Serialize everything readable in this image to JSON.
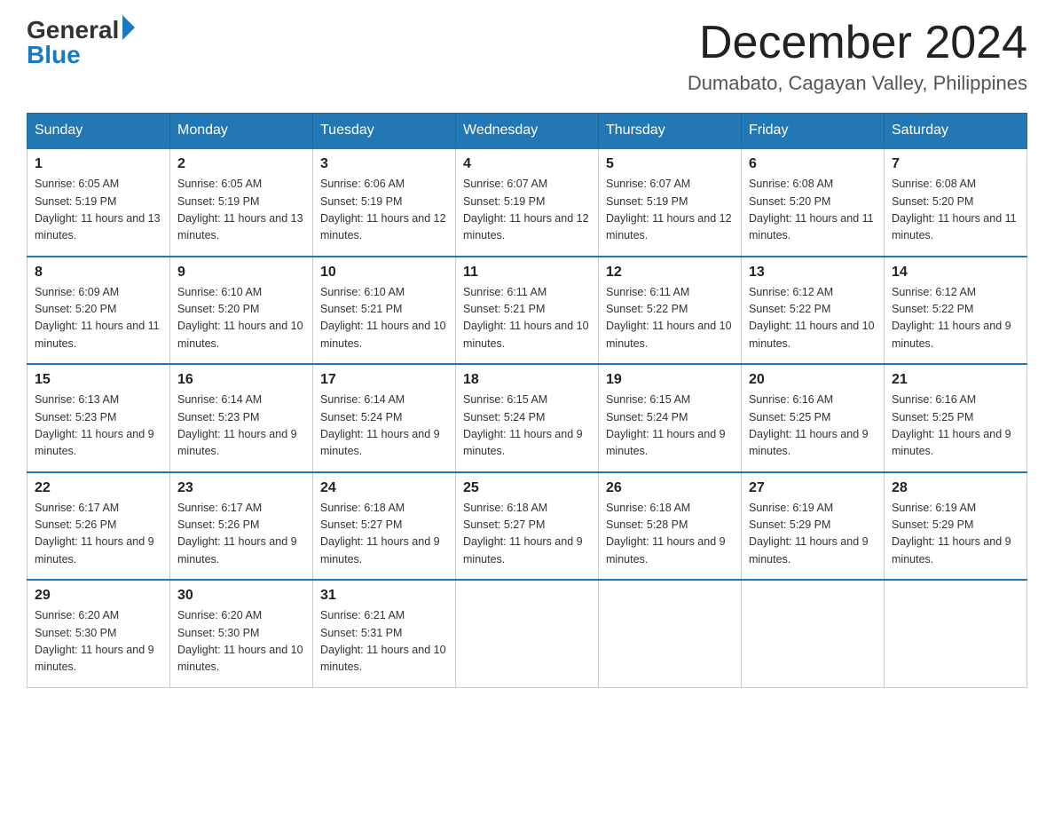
{
  "header": {
    "logo_general": "General",
    "logo_blue": "Blue",
    "month_title": "December 2024",
    "location": "Dumabato, Cagayan Valley, Philippines"
  },
  "weekdays": [
    "Sunday",
    "Monday",
    "Tuesday",
    "Wednesday",
    "Thursday",
    "Friday",
    "Saturday"
  ],
  "weeks": [
    [
      {
        "day": "1",
        "sunrise": "6:05 AM",
        "sunset": "5:19 PM",
        "daylight": "11 hours and 13 minutes."
      },
      {
        "day": "2",
        "sunrise": "6:05 AM",
        "sunset": "5:19 PM",
        "daylight": "11 hours and 13 minutes."
      },
      {
        "day": "3",
        "sunrise": "6:06 AM",
        "sunset": "5:19 PM",
        "daylight": "11 hours and 12 minutes."
      },
      {
        "day": "4",
        "sunrise": "6:07 AM",
        "sunset": "5:19 PM",
        "daylight": "11 hours and 12 minutes."
      },
      {
        "day": "5",
        "sunrise": "6:07 AM",
        "sunset": "5:19 PM",
        "daylight": "11 hours and 12 minutes."
      },
      {
        "day": "6",
        "sunrise": "6:08 AM",
        "sunset": "5:20 PM",
        "daylight": "11 hours and 11 minutes."
      },
      {
        "day": "7",
        "sunrise": "6:08 AM",
        "sunset": "5:20 PM",
        "daylight": "11 hours and 11 minutes."
      }
    ],
    [
      {
        "day": "8",
        "sunrise": "6:09 AM",
        "sunset": "5:20 PM",
        "daylight": "11 hours and 11 minutes."
      },
      {
        "day": "9",
        "sunrise": "6:10 AM",
        "sunset": "5:20 PM",
        "daylight": "11 hours and 10 minutes."
      },
      {
        "day": "10",
        "sunrise": "6:10 AM",
        "sunset": "5:21 PM",
        "daylight": "11 hours and 10 minutes."
      },
      {
        "day": "11",
        "sunrise": "6:11 AM",
        "sunset": "5:21 PM",
        "daylight": "11 hours and 10 minutes."
      },
      {
        "day": "12",
        "sunrise": "6:11 AM",
        "sunset": "5:22 PM",
        "daylight": "11 hours and 10 minutes."
      },
      {
        "day": "13",
        "sunrise": "6:12 AM",
        "sunset": "5:22 PM",
        "daylight": "11 hours and 10 minutes."
      },
      {
        "day": "14",
        "sunrise": "6:12 AM",
        "sunset": "5:22 PM",
        "daylight": "11 hours and 9 minutes."
      }
    ],
    [
      {
        "day": "15",
        "sunrise": "6:13 AM",
        "sunset": "5:23 PM",
        "daylight": "11 hours and 9 minutes."
      },
      {
        "day": "16",
        "sunrise": "6:14 AM",
        "sunset": "5:23 PM",
        "daylight": "11 hours and 9 minutes."
      },
      {
        "day": "17",
        "sunrise": "6:14 AM",
        "sunset": "5:24 PM",
        "daylight": "11 hours and 9 minutes."
      },
      {
        "day": "18",
        "sunrise": "6:15 AM",
        "sunset": "5:24 PM",
        "daylight": "11 hours and 9 minutes."
      },
      {
        "day": "19",
        "sunrise": "6:15 AM",
        "sunset": "5:24 PM",
        "daylight": "11 hours and 9 minutes."
      },
      {
        "day": "20",
        "sunrise": "6:16 AM",
        "sunset": "5:25 PM",
        "daylight": "11 hours and 9 minutes."
      },
      {
        "day": "21",
        "sunrise": "6:16 AM",
        "sunset": "5:25 PM",
        "daylight": "11 hours and 9 minutes."
      }
    ],
    [
      {
        "day": "22",
        "sunrise": "6:17 AM",
        "sunset": "5:26 PM",
        "daylight": "11 hours and 9 minutes."
      },
      {
        "day": "23",
        "sunrise": "6:17 AM",
        "sunset": "5:26 PM",
        "daylight": "11 hours and 9 minutes."
      },
      {
        "day": "24",
        "sunrise": "6:18 AM",
        "sunset": "5:27 PM",
        "daylight": "11 hours and 9 minutes."
      },
      {
        "day": "25",
        "sunrise": "6:18 AM",
        "sunset": "5:27 PM",
        "daylight": "11 hours and 9 minutes."
      },
      {
        "day": "26",
        "sunrise": "6:18 AM",
        "sunset": "5:28 PM",
        "daylight": "11 hours and 9 minutes."
      },
      {
        "day": "27",
        "sunrise": "6:19 AM",
        "sunset": "5:29 PM",
        "daylight": "11 hours and 9 minutes."
      },
      {
        "day": "28",
        "sunrise": "6:19 AM",
        "sunset": "5:29 PM",
        "daylight": "11 hours and 9 minutes."
      }
    ],
    [
      {
        "day": "29",
        "sunrise": "6:20 AM",
        "sunset": "5:30 PM",
        "daylight": "11 hours and 9 minutes."
      },
      {
        "day": "30",
        "sunrise": "6:20 AM",
        "sunset": "5:30 PM",
        "daylight": "11 hours and 10 minutes."
      },
      {
        "day": "31",
        "sunrise": "6:21 AM",
        "sunset": "5:31 PM",
        "daylight": "11 hours and 10 minutes."
      },
      null,
      null,
      null,
      null
    ]
  ]
}
